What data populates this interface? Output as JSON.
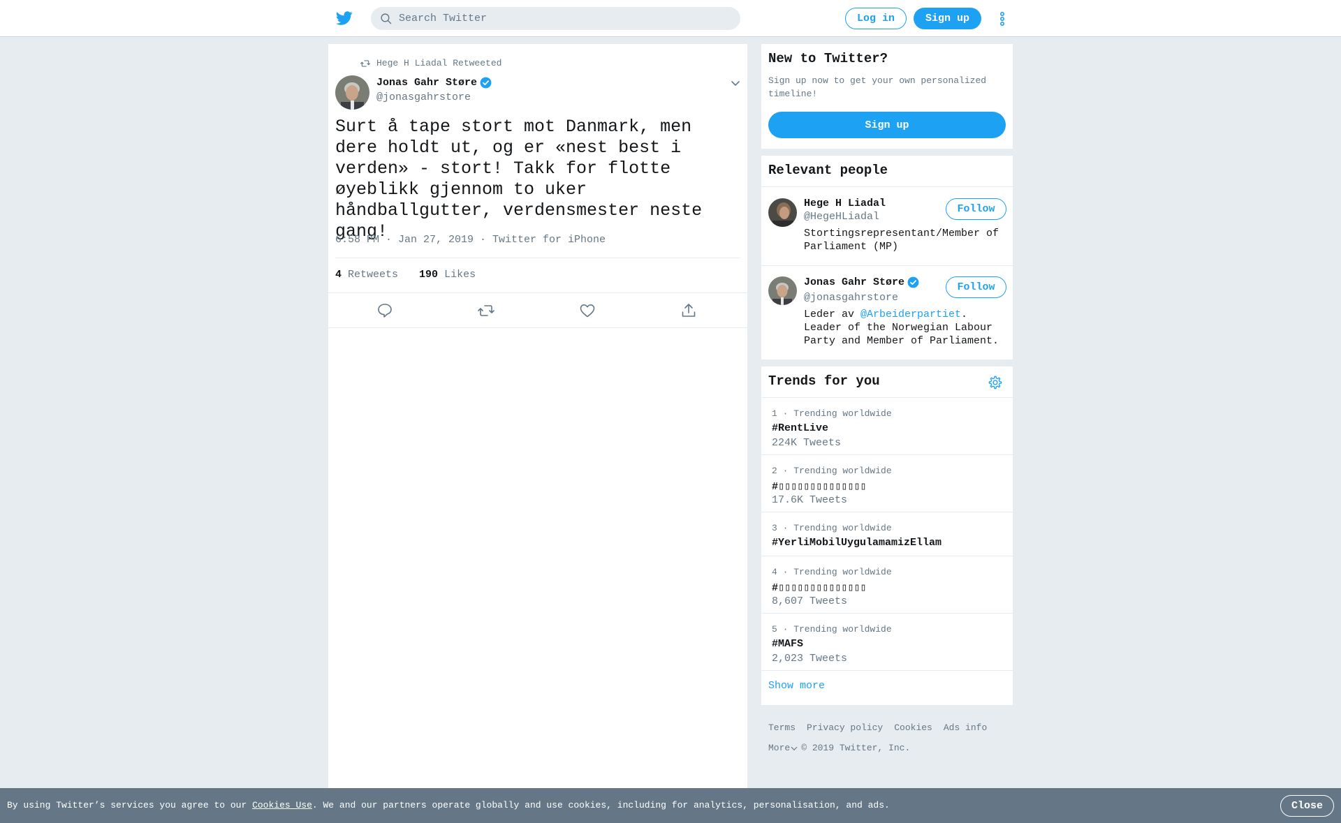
{
  "header": {
    "search_placeholder": "Search Twitter",
    "login_label": "Log in",
    "signup_label": "Sign up",
    "brand_color": "#1da1f2",
    "logo_icon": "twitter-bird-icon",
    "more_icon": "vertical-dots-icon"
  },
  "tweet": {
    "retweeted_by": "Hege H Liadal Retweeted",
    "author_name": "Jonas Gahr Støre",
    "author_handle": "@jonasgahrstore",
    "text": "Surt å tape stort mot Danmark, men dere holdt ut, og er «nest best i verden» - stort! Takk for flotte øyeblikk gjennom to uker håndballgutter, verdensmester neste gang!",
    "meta": "6:58 PM · Jan 27, 2019 · Twitter for iPhone",
    "retweets_count": "4",
    "retweets_label": "Retweets",
    "likes_count": "190",
    "likes_label": "Likes",
    "actions": [
      "reply-icon",
      "retweet-icon",
      "like-icon",
      "share-icon"
    ]
  },
  "new_to_twitter": {
    "title": "New to Twitter?",
    "subtitle": "Sign up now to get your own personalized timeline!",
    "signup_label": "Sign up"
  },
  "relevant_people": {
    "title": "Relevant people",
    "people": [
      {
        "name": "Hege H Liadal",
        "handle": "@HegeHLiadal",
        "bio": "Stortingsrepresentant/Member of Parliament (MP)",
        "follow_label": "Follow",
        "verified": false
      },
      {
        "name": "Jonas Gahr Støre",
        "handle": "@jonasgahrstore",
        "bio_prefix": "Leder av ",
        "bio_mention": "@Arbeiderpartiet",
        "bio_suffix": ". Leader of the Norwegian Labour Party and Member of Parliament.",
        "follow_label": "Follow",
        "verified": true
      }
    ]
  },
  "trends": {
    "title": "Trends for you",
    "items": [
      {
        "meta": "1 · Trending worldwide",
        "name": "#RentLive",
        "count": "224K Tweets"
      },
      {
        "meta": "2 · Trending worldwide",
        "name": "#▯▯▯▯▯▯▯▯▯▯▯▯▯▯",
        "count": "17.6K Tweets"
      },
      {
        "meta": "3 · Trending worldwide",
        "name": "#YerliMobilUygulamamizEllam",
        "count": ""
      },
      {
        "meta": "4 · Trending worldwide",
        "name": "#▯▯▯▯▯▯▯▯▯▯▯▯▯▯",
        "count": "8,607 Tweets"
      },
      {
        "meta": "5 · Trending worldwide",
        "name": "#MAFS",
        "count": "2,023 Tweets"
      }
    ],
    "show_more": "Show more"
  },
  "footer": {
    "links": [
      "Terms",
      "Privacy policy",
      "Cookies",
      "Ads info"
    ],
    "more_label": "More",
    "copyright": "© 2019 Twitter, Inc."
  },
  "cookie_banner": {
    "text_before": "By using Twitter’s services you agree to our ",
    "link": "Cookies Use",
    "text_after": ". We and our partners operate globally and use cookies, including for analytics, personalisation, and ads.",
    "close_label": "Close"
  }
}
